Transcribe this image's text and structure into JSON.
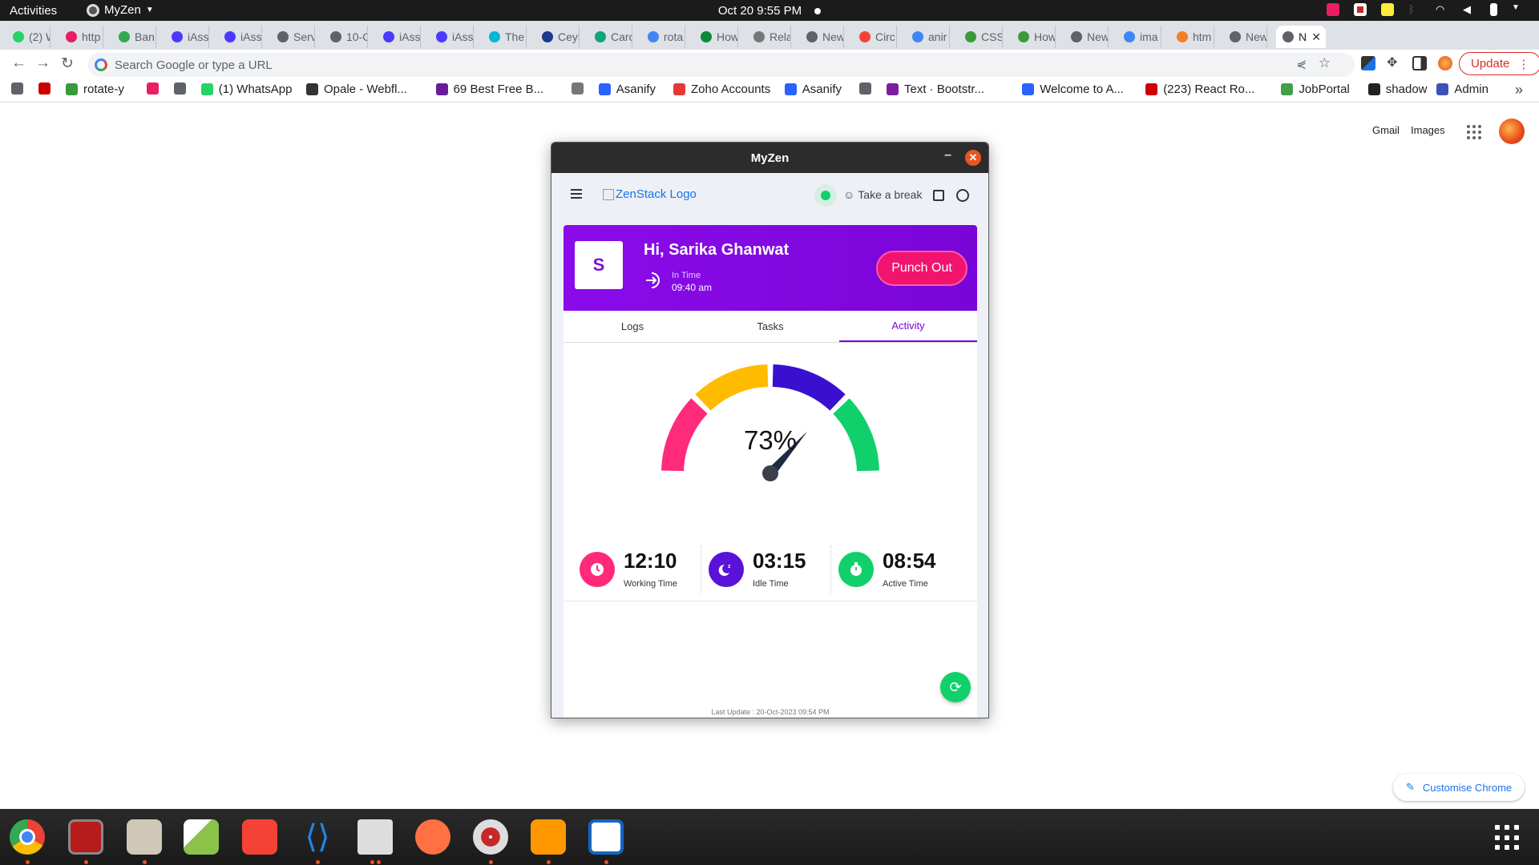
{
  "topbar": {
    "activities": "Activities",
    "app_name": "MyZen",
    "clock": "Oct 20  9:55 PM"
  },
  "browser": {
    "tabs": [
      {
        "label": "(2) W",
        "color": "#25d366"
      },
      {
        "label": "http",
        "color": "#e91e63"
      },
      {
        "label": "Ban",
        "color": "#34a853"
      },
      {
        "label": "iAss",
        "color": "#4a3aff"
      },
      {
        "label": "iAss",
        "color": "#4a3aff"
      },
      {
        "label": "Serv",
        "color": "#5f6368"
      },
      {
        "label": "10-C",
        "color": "#5f6368"
      },
      {
        "label": "iAss",
        "color": "#4a3aff"
      },
      {
        "label": "iAss",
        "color": "#4a3aff"
      },
      {
        "label": "The",
        "color": "#06b6d4"
      },
      {
        "label": "Ceyl",
        "color": "#1e3a8a"
      },
      {
        "label": "Carc",
        "color": "#10a37f"
      },
      {
        "label": "rota",
        "color": "#4285f4"
      },
      {
        "label": "How",
        "color": "#0a8a3a"
      },
      {
        "label": "Rela",
        "color": "#777"
      },
      {
        "label": "New",
        "color": "#5f6368"
      },
      {
        "label": "Circ",
        "color": "#f44336"
      },
      {
        "label": "anir",
        "color": "#4285f4"
      },
      {
        "label": "CSS",
        "color": "#3a9a3a"
      },
      {
        "label": "How",
        "color": "#3a9a3a"
      },
      {
        "label": "New",
        "color": "#5f6368"
      },
      {
        "label": "ima",
        "color": "#4285f4"
      },
      {
        "label": "htm",
        "color": "#f48024"
      },
      {
        "label": "New",
        "color": "#5f6368"
      },
      {
        "label": "N",
        "color": "#5f6368"
      }
    ],
    "new_tab": "+",
    "omnibox_placeholder": "Search Google or type a URL",
    "update_label": "Update",
    "bookmarks": [
      {
        "label": "",
        "color": "#5f6368"
      },
      {
        "label": "",
        "color": "#cc0000"
      },
      {
        "label": "rotate-y",
        "color": "#3a9a3a"
      },
      {
        "label": "",
        "color": "#e91e63"
      },
      {
        "label": "",
        "color": "#5f6368"
      },
      {
        "label": "(1) WhatsApp",
        "color": "#25d366"
      },
      {
        "label": "Opale - Webfl...",
        "color": "#333"
      },
      {
        "label": "69 Best Free B...",
        "color": "#6a1b9a"
      },
      {
        "label": "",
        "color": "#777"
      },
      {
        "label": "Asanify",
        "color": "#2962ff"
      },
      {
        "label": "Zoho Accounts",
        "color": "#e53935"
      },
      {
        "label": "Asanify",
        "color": "#2962ff"
      },
      {
        "label": "",
        "color": "#5f6368"
      },
      {
        "label": "Text · Bootstr...",
        "color": "#7b1fa2"
      },
      {
        "label": "Welcome to A...",
        "color": "#2962ff"
      },
      {
        "label": "(223) React Ro...",
        "color": "#cc0000"
      },
      {
        "label": "JobPortal",
        "color": "#43a047"
      },
      {
        "label": "shadow",
        "color": "#222"
      },
      {
        "label": "Admin",
        "color": "#3f51b5"
      }
    ]
  },
  "newtab": {
    "gmail": "Gmail",
    "images": "Images",
    "customise": "Customise Chrome"
  },
  "myzen": {
    "window_title": "MyZen",
    "logo_alt": "ZenStack Logo",
    "take_break": "Take a break",
    "user_initial": "S",
    "greeting": "Hi, Sarika Ghanwat",
    "in_time_label": "In Time",
    "in_time_value": "09:40 am",
    "punch_out": "Punch Out",
    "tabs": [
      "Logs",
      "Tasks",
      "Activity"
    ],
    "active_tab": "Activity",
    "gauge_percent": "73%",
    "gauge_value": 73,
    "gauge_colors": [
      "#ff2a7a",
      "#ffbb00",
      "#3a0fd0",
      "#10d06b"
    ],
    "stats": [
      {
        "value": "12:10",
        "label": "Working Time",
        "color": "#ff2a7a"
      },
      {
        "value": "03:15",
        "label": "Idle Time",
        "color": "#5a12d8"
      },
      {
        "value": "08:54",
        "label": "Active Time",
        "color": "#10d06b"
      }
    ],
    "last_update": "Last Update : 20-Oct-2023 09:54 PM"
  }
}
